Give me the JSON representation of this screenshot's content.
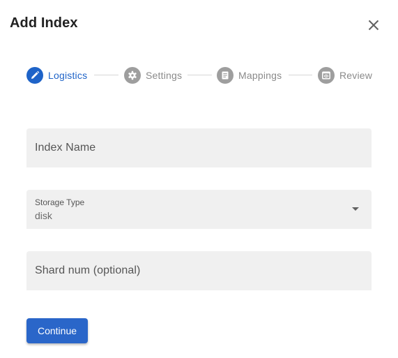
{
  "dialog": {
    "title": "Add Index",
    "close_icon": "close-icon"
  },
  "stepper": {
    "steps": [
      {
        "label": "Logistics",
        "icon": "pencil-icon",
        "state": "active"
      },
      {
        "label": "Settings",
        "icon": "gear-icon",
        "state": "inactive"
      },
      {
        "label": "Mappings",
        "icon": "document-icon",
        "state": "inactive"
      },
      {
        "label": "Review",
        "icon": "preview-icon",
        "state": "inactive"
      }
    ]
  },
  "form": {
    "index_name": {
      "placeholder": "Index Name",
      "value": ""
    },
    "storage_type": {
      "label": "Storage Type",
      "value": "disk"
    },
    "shard_num": {
      "placeholder": "Shard num (optional)",
      "value": ""
    }
  },
  "actions": {
    "continue_label": "Continue"
  },
  "colors": {
    "accent": "#1e63c8",
    "button": "#2a66c9",
    "inactive_step": "#9e9e9e",
    "field_background": "#f0f0f0"
  }
}
